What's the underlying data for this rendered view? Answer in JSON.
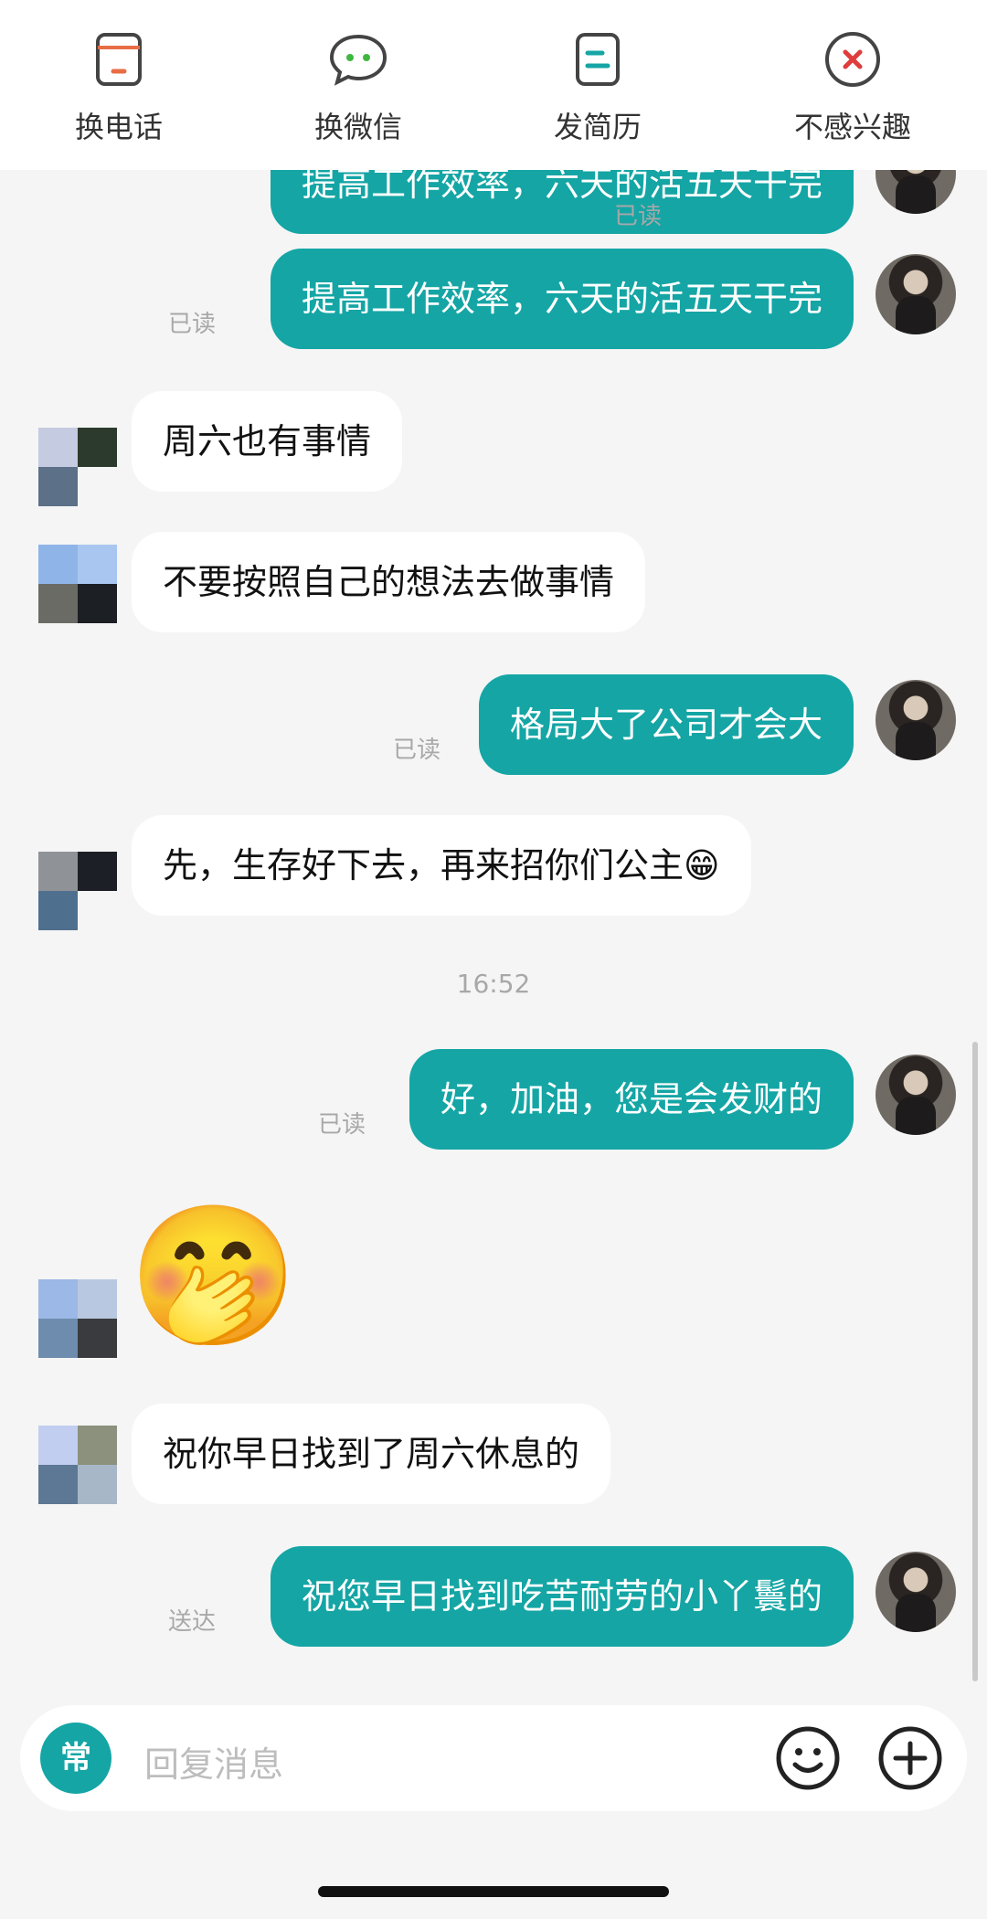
{
  "toolbar": {
    "items": [
      {
        "label": "换电话",
        "icon": "phone-card-icon"
      },
      {
        "label": "换微信",
        "icon": "wechat-bubble-icon"
      },
      {
        "label": "发简历",
        "icon": "resume-doc-icon"
      },
      {
        "label": "不感兴趣",
        "icon": "close-circle-icon"
      }
    ]
  },
  "messages": [
    {
      "dir": "out",
      "text": "提高工作效率，六天的活五天干完",
      "status": "已读"
    },
    {
      "dir": "out",
      "text": "提高工作效率，六天的活五天干完",
      "status": "已读"
    },
    {
      "dir": "in",
      "text": "周六也有事情"
    },
    {
      "dir": "in",
      "text": "不要按照自己的想法去做事情"
    },
    {
      "dir": "out",
      "text": "格局大了公司才会大",
      "status": "已读"
    },
    {
      "dir": "in",
      "text": "先，生存好下去，再来招你们公主😁"
    },
    {
      "dir": "out",
      "text": "好，加油，您是会发财的",
      "status": "已读"
    },
    {
      "dir": "in",
      "text": "🤭"
    },
    {
      "dir": "in",
      "text": "祝你早日找到了周六休息的"
    },
    {
      "dir": "out",
      "text": "祝您早日找到吃苦耐劳的小丫鬟的",
      "status": "送达"
    }
  ],
  "timestamp": "16:52",
  "input": {
    "common_label": "常",
    "placeholder": "回复消息"
  },
  "colors": {
    "accent": "#15a5a5",
    "background": "#f5f5f5",
    "status_text": "#a8a8a8"
  }
}
